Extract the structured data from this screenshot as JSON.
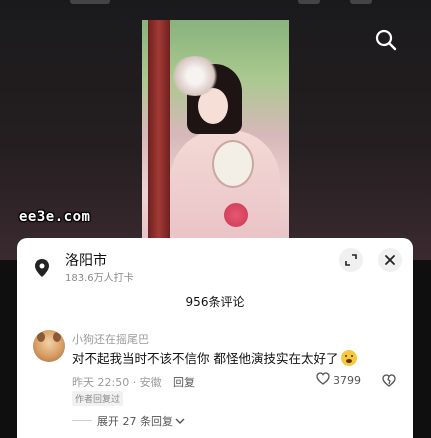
{
  "watermark": "ee3e.com",
  "location": {
    "name": "洛阳市",
    "checkins": "183.6万人打卡"
  },
  "comments_header": {
    "count_label": "956条评论"
  },
  "comment": {
    "author": "小狗还在摇尾巴",
    "text": "对不起我当时不该不信你 都怪他演技实在太好了",
    "emoji": "flushed-face-emoji",
    "time_location": "昨天 22:50 · 安徽",
    "reply_label": "回复",
    "likes": "3799",
    "author_replied_tag": "作者回复过",
    "expand_replies": "展开 27 条回复"
  },
  "icons": {
    "search": "search-icon",
    "location": "location-pin-icon",
    "expand": "expand-icon",
    "close": "close-icon",
    "like": "heart-icon",
    "dislike": "broken-heart-icon",
    "chevron": "chevron-down-icon"
  }
}
